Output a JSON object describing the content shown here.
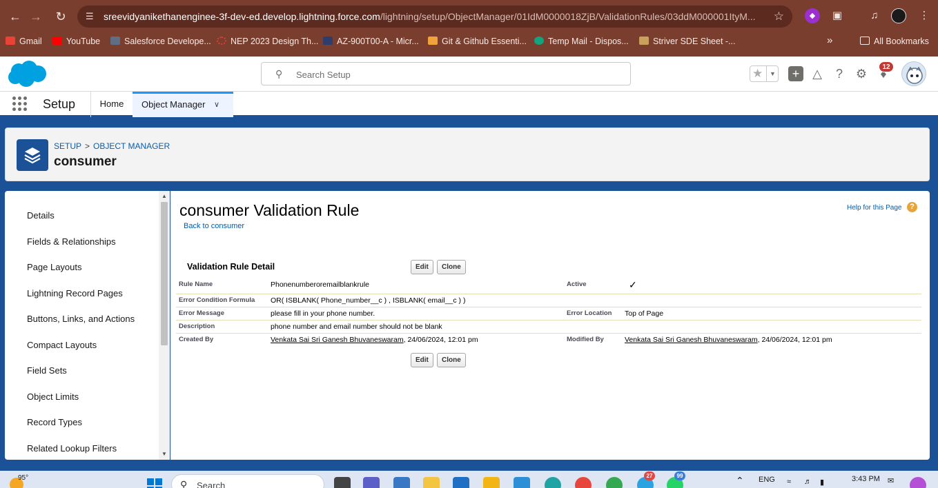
{
  "browser": {
    "url_host": "sreevidyanikethanenginee-3f-dev-ed.develop.lightning.force.com",
    "url_path": "/lightning/setup/ObjectManager/01IdM0000018ZjB/ValidationRules/03ddM000001ItyM...",
    "bookmarks": [
      {
        "label": "Gmail",
        "color": "#ea4335"
      },
      {
        "label": "YouTube",
        "color": "#ff0000"
      },
      {
        "label": "Salesforce Develope...",
        "color": "#00a1e0"
      },
      {
        "label": "NEP 2023 Design Th...",
        "color": "#d93025"
      },
      {
        "label": "AZ-900T00-A - Micr...",
        "color": "#0f1c3f"
      },
      {
        "label": "Git & Github Essenti...",
        "color": "#f1a33a"
      },
      {
        "label": "Temp Mail - Dispos...",
        "color": "#12a37f"
      },
      {
        "label": "Striver SDE Sheet -...",
        "color": "#c8a25a"
      }
    ],
    "all_bookmarks_label": "All Bookmarks",
    "more_label": "»"
  },
  "header": {
    "search_placeholder": "Search Setup",
    "notification_count": "12"
  },
  "app_nav": {
    "app_name": "Setup",
    "home_label": "Home",
    "object_manager_label": "Object Manager"
  },
  "page_header": {
    "breadcrumb_setup": "SETUP",
    "breadcrumb_sep": ">",
    "breadcrumb_object_manager": "OBJECT MANAGER",
    "title": "consumer"
  },
  "sidebar": {
    "items": [
      "Details",
      "Fields & Relationships",
      "Page Layouts",
      "Lightning Record Pages",
      "Buttons, Links, and Actions",
      "Compact Layouts",
      "Field Sets",
      "Object Limits",
      "Record Types",
      "Related Lookup Filters"
    ]
  },
  "main": {
    "title": "consumer Validation Rule",
    "back_link": "Back to consumer",
    "help_link": "Help for this Page",
    "section_title": "Validation Rule Detail",
    "edit_label": "Edit",
    "clone_label": "Clone",
    "fields": {
      "rule_name_label": "Rule Name",
      "rule_name_value": "Phonenumberoremailblankrule",
      "active_label": "Active",
      "active_check": "✓",
      "formula_label": "Error Condition Formula",
      "formula_value": "OR( ISBLANK( Phone_number__c ) , ISBLANK( email__c ) )",
      "error_message_label": "Error Message",
      "error_message_value": "please fill in your phone number.",
      "error_location_label": "Error Location",
      "error_location_value": "Top of Page",
      "description_label": "Description",
      "description_value": "phone number and email number should not be blank",
      "created_by_label": "Created By",
      "created_by_user": "Venkata Sai Sri Ganesh Bhuvaneswaram",
      "created_by_date": ", 24/06/2024, 12:01 pm",
      "modified_by_label": "Modified By",
      "modified_by_user": "Venkata Sai Sri Ganesh Bhuvaneswaram",
      "modified_by_date": ", 24/06/2024, 12:01 pm"
    }
  },
  "taskbar": {
    "temperature": "95°",
    "search_label": "Search",
    "language": "ENG",
    "time": "3:43 PM",
    "badge_1": "27",
    "badge_2": "99"
  },
  "colors": {
    "salesforce_blue": "#1b5297",
    "link_blue": "#015ba7",
    "browser_bar": "#7a3e2e",
    "notification_red": "#c23934"
  }
}
